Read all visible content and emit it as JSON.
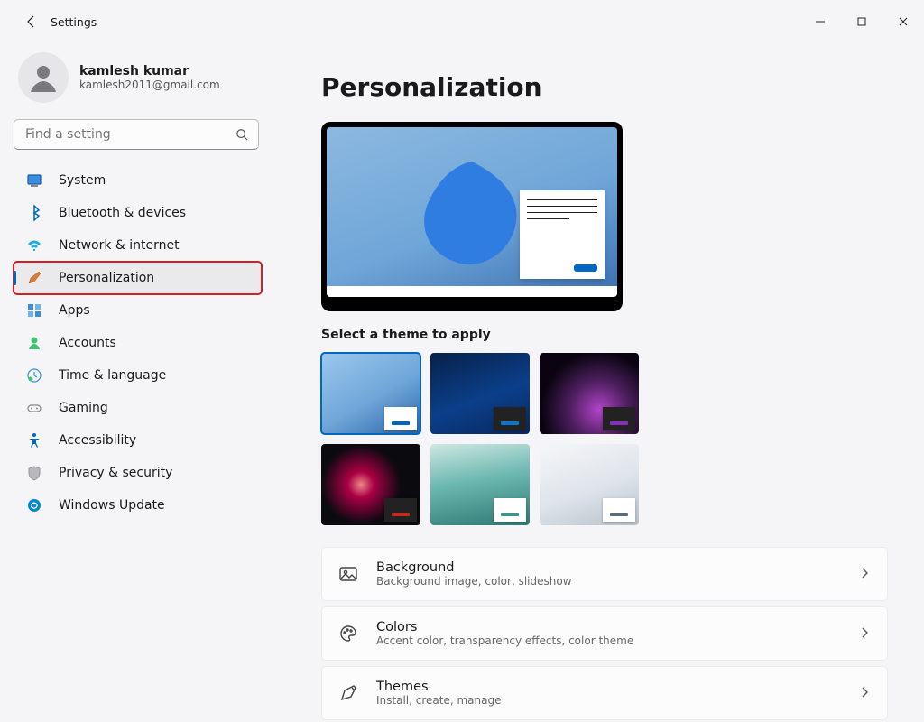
{
  "window": {
    "title": "Settings"
  },
  "user": {
    "name": "kamlesh kumar",
    "email": "kamlesh2011@gmail.com"
  },
  "search": {
    "placeholder": "Find a setting"
  },
  "nav": [
    {
      "id": "system",
      "label": "System"
    },
    {
      "id": "bluetooth",
      "label": "Bluetooth & devices"
    },
    {
      "id": "network",
      "label": "Network & internet"
    },
    {
      "id": "personalization",
      "label": "Personalization",
      "selected": true,
      "highlighted": true
    },
    {
      "id": "apps",
      "label": "Apps"
    },
    {
      "id": "accounts",
      "label": "Accounts"
    },
    {
      "id": "time",
      "label": "Time & language"
    },
    {
      "id": "gaming",
      "label": "Gaming"
    },
    {
      "id": "accessibility",
      "label": "Accessibility"
    },
    {
      "id": "privacy",
      "label": "Privacy & security"
    },
    {
      "id": "update",
      "label": "Windows Update"
    }
  ],
  "page": {
    "title": "Personalization",
    "theme_label": "Select a theme to apply",
    "themes": [
      {
        "accent": "#0067c0",
        "swatch": "light",
        "selected": true
      },
      {
        "accent": "#0078d4",
        "swatch": "dark"
      },
      {
        "accent": "#8a2cc2",
        "swatch": "dark"
      },
      {
        "accent": "#c42b1c",
        "swatch": "dark"
      },
      {
        "accent": "#3e938a",
        "swatch": "light"
      },
      {
        "accent": "#5c6b77",
        "swatch": "light"
      }
    ],
    "options": [
      {
        "title": "Background",
        "desc": "Background image, color, slideshow",
        "icon": "background"
      },
      {
        "title": "Colors",
        "desc": "Accent color, transparency effects, color theme",
        "icon": "colors"
      },
      {
        "title": "Themes",
        "desc": "Install, create, manage",
        "icon": "themes"
      }
    ]
  }
}
